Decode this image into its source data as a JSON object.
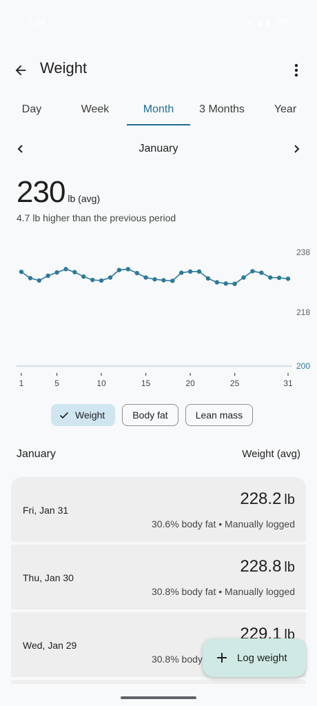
{
  "status_bar": {
    "time": "7:34",
    "battery": "72%"
  },
  "app_bar": {
    "title": "Weight"
  },
  "tabs": [
    {
      "label": "Day",
      "active": false
    },
    {
      "label": "Week",
      "active": false
    },
    {
      "label": "Month",
      "active": true
    },
    {
      "label": "3 Months",
      "active": false
    },
    {
      "label": "Year",
      "active": false
    }
  ],
  "period": {
    "label": "January"
  },
  "summary": {
    "value": "230",
    "unit": "lb (avg)",
    "comparison": "4.7 lb higher than the previous period"
  },
  "chart_data": {
    "type": "line",
    "x": [
      1,
      2,
      3,
      4,
      5,
      6,
      7,
      8,
      9,
      10,
      11,
      12,
      13,
      14,
      15,
      16,
      17,
      18,
      19,
      20,
      21,
      22,
      23,
      24,
      25,
      26,
      27,
      28,
      29,
      30,
      31
    ],
    "series": [
      {
        "values": [
          231.5,
          229.4,
          228.6,
          230.2,
          231.3,
          232.4,
          231.4,
          229.9,
          228.8,
          228.6,
          229.6,
          232.1,
          232.4,
          231.1,
          229.6,
          229.0,
          228.7,
          228.5,
          231.2,
          231.6,
          231.6,
          229.3,
          228.0,
          227.6,
          227.5,
          229.6,
          231.7,
          231.2,
          229.6,
          229.5,
          229.2
        ]
      }
    ],
    "y_ticks": [
      "238",
      "218",
      "200"
    ],
    "x_ticks": [
      "1",
      "5",
      "10",
      "15",
      "20",
      "25",
      "31"
    ],
    "baseline_label": "200",
    "ylim": [
      200,
      238
    ],
    "color": "#2b7a99"
  },
  "chips": [
    {
      "label": "Weight",
      "selected": true
    },
    {
      "label": "Body fat",
      "selected": false
    },
    {
      "label": "Lean mass",
      "selected": false
    }
  ],
  "list": {
    "header_left": "January",
    "header_right": "Weight (avg)",
    "entries": [
      {
        "date": "Fri, Jan 31",
        "value": "228.2",
        "unit": "lb",
        "details": "30.6% body fat • Manually logged"
      },
      {
        "date": "Thu, Jan 30",
        "value": "228.8",
        "unit": "lb",
        "details": "30.8% body fat • Manually logged"
      },
      {
        "date": "Wed, Jan 29",
        "value": "229.1",
        "unit": "lb",
        "details": "30.8% body fat • Manually logged"
      }
    ]
  },
  "fab": {
    "label": "Log weight"
  },
  "colors": {
    "accent": "#1e6c93",
    "chip_selected": "#cfe6f1",
    "fab": "#cfe9e4",
    "card": "#eeeeee"
  }
}
